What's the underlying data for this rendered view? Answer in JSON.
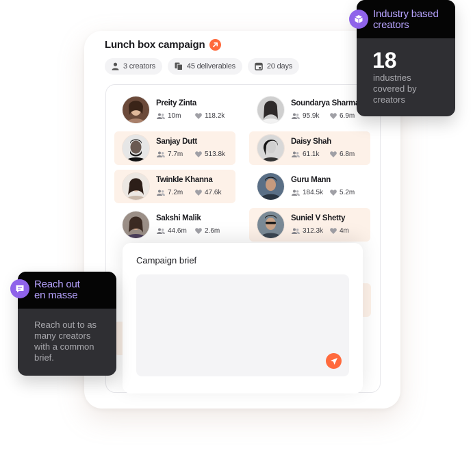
{
  "campaign": {
    "title": "Lunch box campaign",
    "chips": [
      {
        "icon": "person-icon",
        "label": "3 creators"
      },
      {
        "icon": "copy-icon",
        "label": "45 deliverables"
      },
      {
        "icon": "calendar-icon",
        "label": "20 days"
      }
    ]
  },
  "creators": [
    {
      "name": "Preity Zinta",
      "followers": "10m",
      "likes": "118.2k",
      "highlighted": false
    },
    {
      "name": "Soundarya Sharma",
      "followers": "95.9k",
      "likes": "6.9m",
      "highlighted": false
    },
    {
      "name": "Sanjay Dutt",
      "followers": "7.7m",
      "likes": "513.8k",
      "highlighted": true
    },
    {
      "name": "Daisy Shah",
      "followers": "61.1k",
      "likes": "6.8m",
      "highlighted": true
    },
    {
      "name": "Twinkle Khanna",
      "followers": "7.2m",
      "likes": "47.6k",
      "highlighted": true
    },
    {
      "name": "Guru Mann",
      "followers": "184.5k",
      "likes": "5.2m",
      "highlighted": false
    },
    {
      "name": "Sakshi Malik",
      "followers": "44.6m",
      "likes": "2.6m",
      "highlighted": false
    },
    {
      "name": "Suniel V Shetty",
      "followers": "312.3k",
      "likes": "4m",
      "highlighted": true
    }
  ],
  "brief": {
    "title": "Campaign brief",
    "value": ""
  },
  "industry_tooltip": {
    "heading": "Industry based creators",
    "heading_line1": "Industry based",
    "heading_line2": "creators",
    "count": "18",
    "caption_line1": "industries",
    "caption_line2": "covered by",
    "caption_line3": "creators"
  },
  "reach_tooltip": {
    "heading_line1": "Reach out",
    "heading_line2": "en masse",
    "body_line1": "Reach out to as",
    "body_line2": "many creators",
    "body_line3": "with a common",
    "body_line4": "brief."
  },
  "colors": {
    "accent": "#ff6a3d",
    "highlight": "#fdf1e8",
    "tooltip_purple": "#b7a3ff",
    "tooltip_dark": "#2f2f33"
  }
}
